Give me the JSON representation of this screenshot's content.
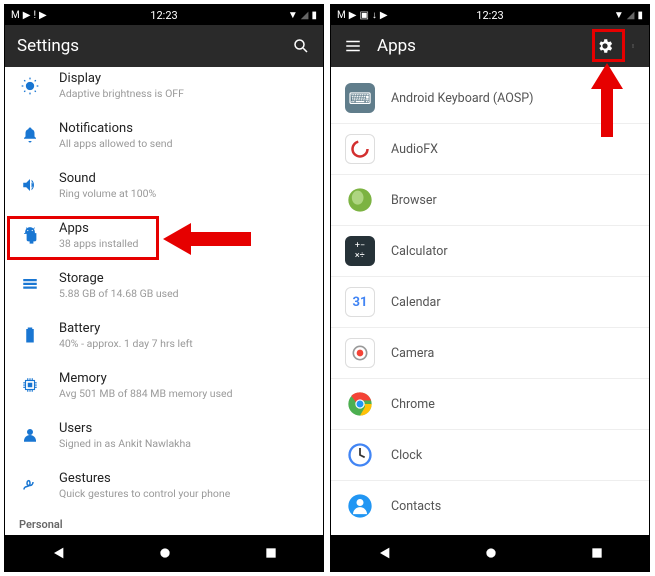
{
  "status": {
    "time": "12:23"
  },
  "left": {
    "title": "Settings",
    "items": [
      {
        "title": "Display",
        "sub": "Adaptive brightness is OFF"
      },
      {
        "title": "Notifications",
        "sub": "All apps allowed to send"
      },
      {
        "title": "Sound",
        "sub": "Ring volume at 100%"
      },
      {
        "title": "Apps",
        "sub": "38 apps installed"
      },
      {
        "title": "Storage",
        "sub": "5.88 GB of 14.68 GB used"
      },
      {
        "title": "Battery",
        "sub": "40% - approx. 1 day 7 hrs left"
      },
      {
        "title": "Memory",
        "sub": "Avg 501 MB of 884 MB memory used"
      },
      {
        "title": "Users",
        "sub": "Signed in as Ankit Nawlakha"
      },
      {
        "title": "Gestures",
        "sub": "Quick gestures to control your phone"
      }
    ],
    "section": "Personal"
  },
  "right": {
    "title": "Apps",
    "apps": [
      {
        "name": "Android Keyboard (AOSP)"
      },
      {
        "name": "AudioFX"
      },
      {
        "name": "Browser"
      },
      {
        "name": "Calculator"
      },
      {
        "name": "Calendar"
      },
      {
        "name": "Camera"
      },
      {
        "name": "Chrome"
      },
      {
        "name": "Clock"
      },
      {
        "name": "Contacts"
      }
    ]
  }
}
